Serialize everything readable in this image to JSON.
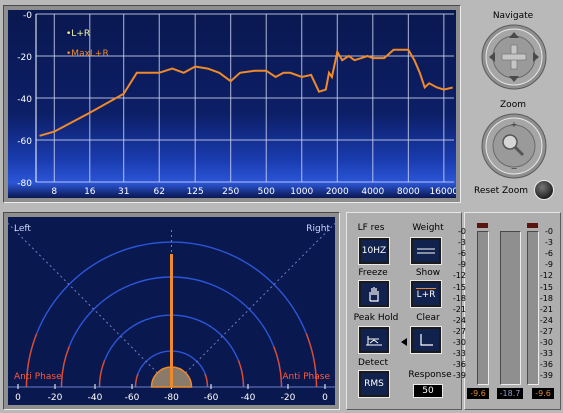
{
  "spectrum": {
    "y_ticks": [
      "-0",
      "-20",
      "-40",
      "-60",
      "-80"
    ],
    "x_ticks": [
      "8",
      "16",
      "31",
      "62",
      "125",
      "250",
      "500",
      "1000",
      "2000",
      "4000",
      "8000",
      "16000"
    ],
    "legend": [
      {
        "label": "•L+R",
        "color": "#f4f4a0"
      },
      {
        "label": "•MaxL+R",
        "color": "#f08a28"
      }
    ],
    "line_color": "#f08a28"
  },
  "chart_data": {
    "type": "line",
    "xscale": "log",
    "x_ticks": [
      8,
      16,
      31,
      62,
      125,
      250,
      500,
      1000,
      2000,
      4000,
      8000,
      16000
    ],
    "ylim": [
      -80,
      0
    ],
    "grid": true,
    "legend_position": "top-left",
    "series": [
      {
        "name": "MaxL+R",
        "x": [
          6,
          8,
          16,
          31,
          40,
          62,
          80,
          100,
          125,
          160,
          200,
          250,
          300,
          400,
          500,
          600,
          700,
          800,
          1000,
          1200,
          1400,
          1600,
          1700,
          1800,
          2000,
          2200,
          2500,
          2800,
          3200,
          3600,
          4000,
          5000,
          6000,
          7000,
          8000,
          9000,
          10000,
          11000,
          12000,
          14000,
          16000,
          19000
        ],
        "y": [
          -58,
          -56,
          -47,
          -38,
          -28,
          -28,
          -26,
          -28,
          -25,
          -26,
          -28,
          -32,
          -28,
          -27,
          -27,
          -30,
          -28,
          -28,
          -30,
          -29,
          -37,
          -36,
          -28,
          -30,
          -18,
          -22,
          -20,
          -22,
          -21,
          -20,
          -21,
          -21,
          -17,
          -17,
          -17,
          -22,
          -28,
          -35,
          -33,
          -35,
          -36,
          -35
        ]
      },
      {
        "name": "L+R",
        "x": [],
        "y": []
      }
    ]
  },
  "navigate": {
    "title": "Navigate"
  },
  "zoom": {
    "title": "Zoom",
    "reset_label": "Reset Zoom"
  },
  "phase": {
    "left_label": "Left",
    "right_label": "Right",
    "anti_phase_left": "Anti Phase",
    "anti_phase_right": "Anti Phase",
    "scale": [
      "0",
      "-20",
      "-40",
      "-60",
      "-80",
      "-60",
      "-40",
      "-20",
      "0"
    ],
    "needle_angle_deg": 0
  },
  "controls": {
    "lf_res": {
      "label": "LF res",
      "value": "10HZ"
    },
    "weight": {
      "label": "Weight"
    },
    "freeze": {
      "label": "Freeze"
    },
    "show": {
      "label": "Show",
      "value": "L+R"
    },
    "peak_hold": {
      "label": "Peak Hold"
    },
    "clear": {
      "label": "Clear"
    },
    "detect": {
      "label": "Detect",
      "value": "RMS"
    },
    "response": {
      "label": "Response",
      "value": "50"
    }
  },
  "meters": {
    "scale": [
      "-0",
      "-3",
      "-6",
      "-9",
      "-12",
      "-15",
      "-18",
      "-21",
      "-24",
      "-27",
      "-30",
      "-33",
      "-36",
      "-39"
    ],
    "left_value": "-9.6",
    "mid_value": "-18.7",
    "right_value": "-9.6",
    "left_level_fraction": 0,
    "mid_level_fraction": 0,
    "right_level_fraction": 0
  }
}
